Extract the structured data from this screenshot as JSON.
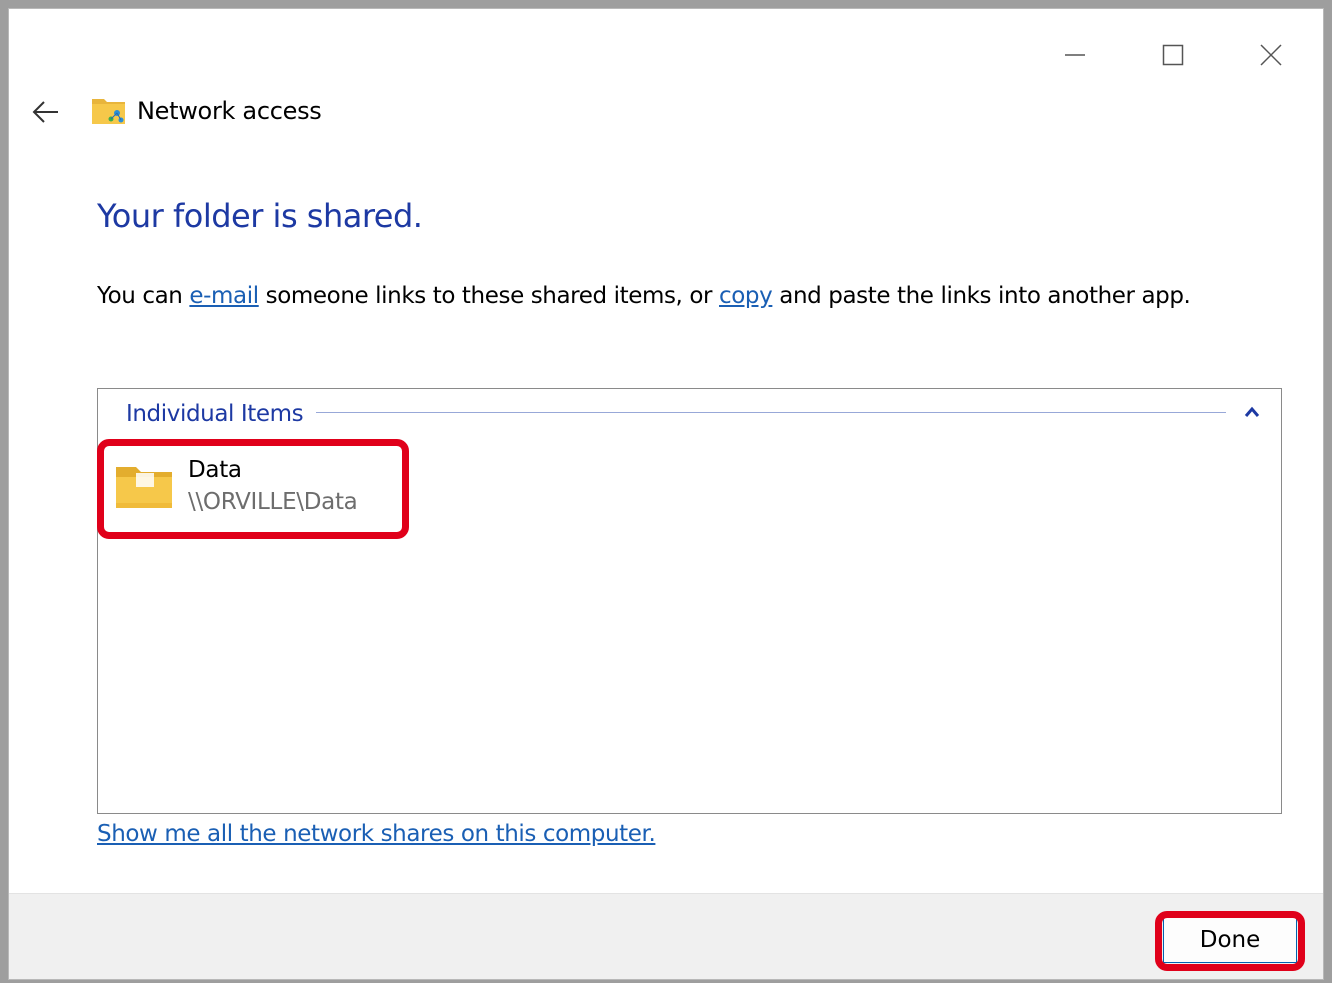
{
  "window": {
    "controls": {
      "minimize_icon": "minimize-icon",
      "maximize_icon": "maximize-icon",
      "close_icon": "close-icon"
    }
  },
  "header": {
    "back_icon": "arrow-left-icon",
    "icon": "network-folder-icon",
    "title": "Network access"
  },
  "main": {
    "heading": "Your folder is shared.",
    "description": {
      "part1": "You can ",
      "email_link": "e-mail",
      "part2": " someone links to these shared items, or ",
      "copy_link": "copy",
      "part3": " and paste the links into another app."
    }
  },
  "items_panel": {
    "group_label": "Individual Items",
    "collapse_icon": "chevron-up-icon",
    "items": [
      {
        "icon": "folder-icon",
        "name": "Data",
        "path": "\\\\ORVILLE\\Data"
      }
    ]
  },
  "shares_link": "Show me all the network shares on this computer.",
  "footer": {
    "done_label": "Done"
  },
  "colors": {
    "heading": "#1d39a3",
    "link": "#1a5fb4",
    "highlight": "#e0001a",
    "footer_bg": "#f0f0f0",
    "folder": "#f6c84a"
  }
}
